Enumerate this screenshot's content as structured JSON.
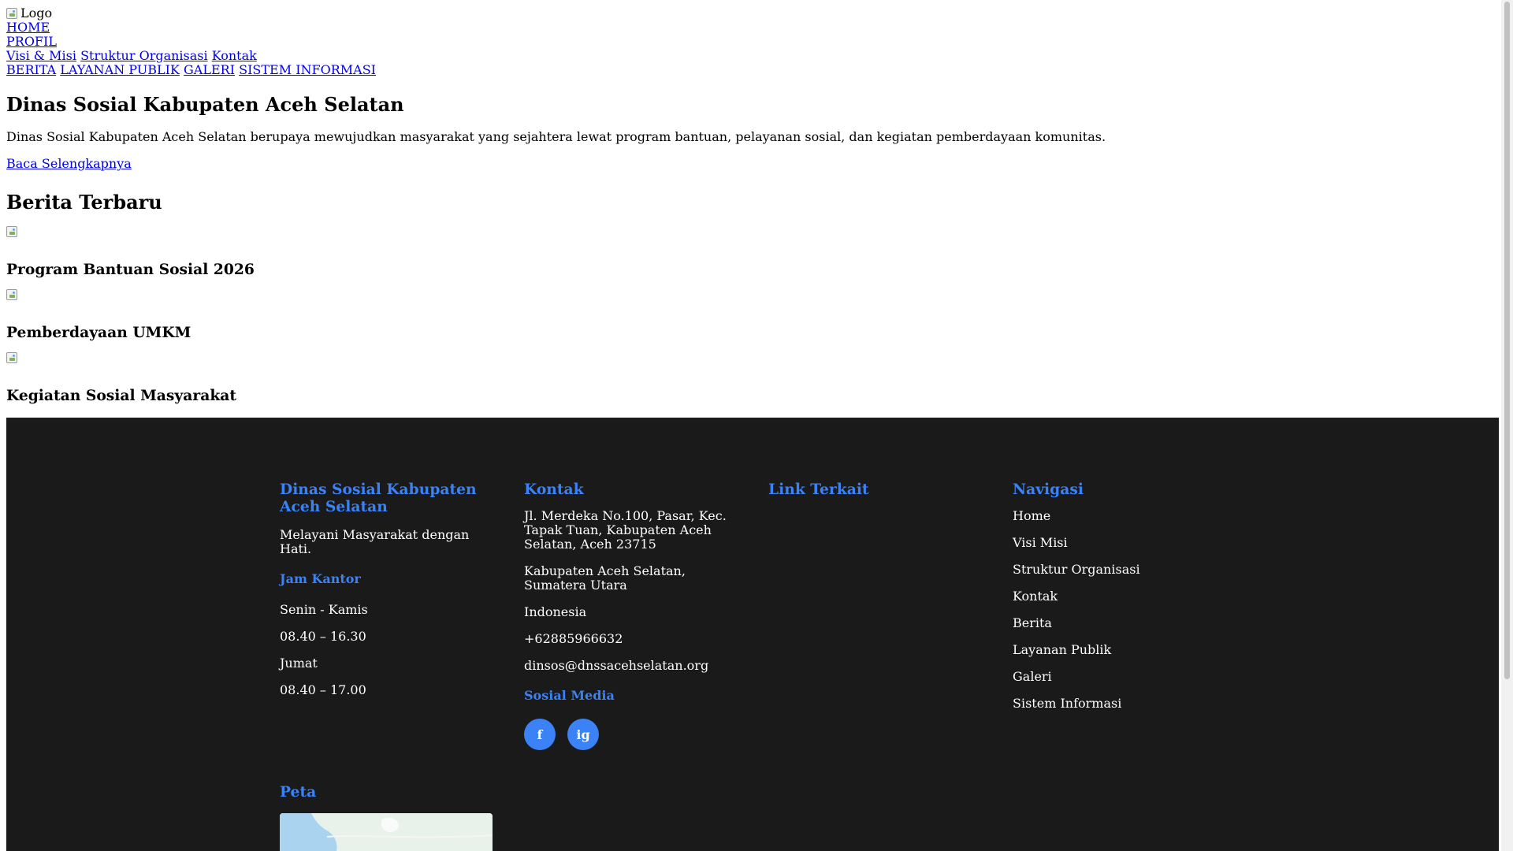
{
  "header": {
    "logo_alt": "Logo",
    "nav": {
      "home": "HOME",
      "profil": "PROFIL",
      "profil_sub": [
        "Visi & Misi",
        "Struktur Organisasi",
        "Kontak"
      ],
      "main": [
        "BERITA",
        "LAYANAN PUBLIK",
        "GALERI",
        "SISTEM INFORMASI"
      ]
    }
  },
  "hero": {
    "title": "Dinas Sosial Kabupaten Aceh Selatan",
    "description": "Dinas Sosial Kabupaten Aceh Selatan berupaya mewujudkan masyarakat yang sejahtera lewat program bantuan, pelayanan sosial, dan kegiatan pemberdayaan komunitas.",
    "read_more": "Baca Selengkapnya"
  },
  "news": {
    "title": "Berita Terbaru",
    "items": [
      {
        "title": "Program Bantuan Sosial 2026"
      },
      {
        "title": "Pemberdayaan UMKM"
      },
      {
        "title": "Kegiatan Sosial Masyarakat"
      }
    ]
  },
  "footer": {
    "about": {
      "title": "Dinas Sosial Kabupaten Aceh Selatan",
      "tagline": "Melayani Masyarakat dengan Hati.",
      "hours_title": "Jam Kantor",
      "hours": [
        "Senin - Kamis",
        "08.40 – 16.30",
        "Jumat",
        "08.40 – 17.00"
      ]
    },
    "contact": {
      "title": "Kontak",
      "address": "Jl. Merdeka No.100, Pasar, Kec. Tapak Tuan, Kabupaten Aceh Selatan, Aceh 23715",
      "region": "Kabupaten Aceh Selatan, Sumatera Utara",
      "country": "Indonesia",
      "phone": "+62885966632",
      "email": "dinsos@dnssacehselatan.org",
      "social_title": "Sosial Media",
      "social": [
        "f",
        "ig"
      ]
    },
    "links": {
      "title": "Link Terkait"
    },
    "navigation": {
      "title": "Navigasi",
      "items": [
        "Home",
        "Visi Misi",
        "Struktur Organisasi",
        "Kontak",
        "Berita",
        "Layanan Publik",
        "Galeri",
        "Sistem Informasi"
      ]
    },
    "map": {
      "title": "Peta"
    }
  },
  "colors": {
    "accent": "#3b82f6",
    "footer_bg": "#1a1a1a",
    "link": "#0000EE"
  }
}
